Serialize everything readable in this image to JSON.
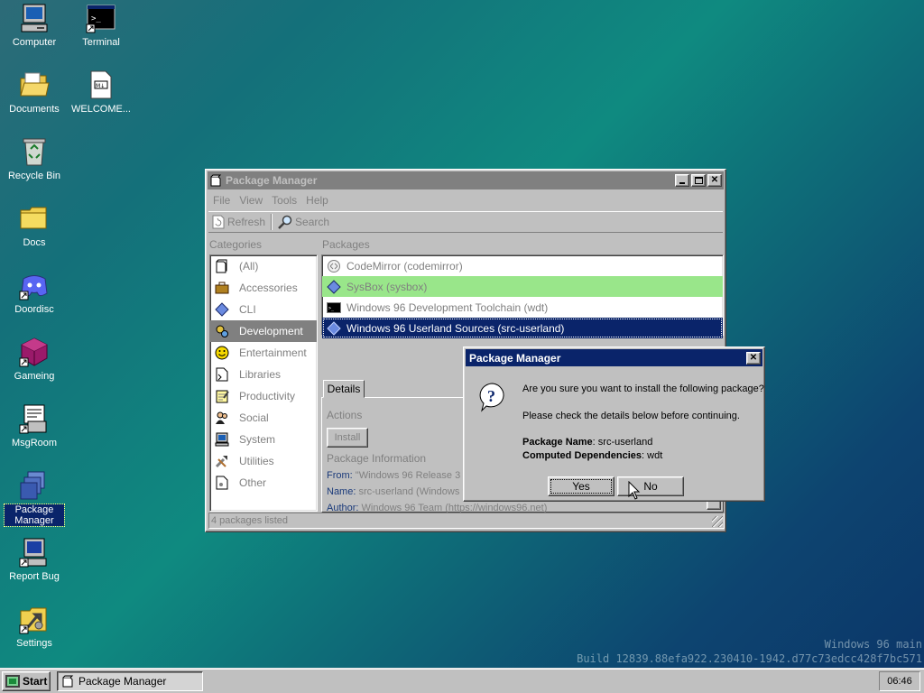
{
  "desktop": {
    "icons": [
      {
        "label": "Computer",
        "icon": "computer-icon"
      },
      {
        "label": "Terminal",
        "icon": "terminal-icon"
      },
      {
        "label": "Documents",
        "icon": "folder-open-icon"
      },
      {
        "label": "WELCOME...",
        "icon": "markdown-file-icon"
      },
      {
        "label": "Recycle Bin",
        "icon": "recycle-bin-icon"
      },
      {
        "label": "Docs",
        "icon": "folder-icon"
      },
      {
        "label": "Doordisc",
        "icon": "discord-icon"
      },
      {
        "label": "Gameing",
        "icon": "game-cube-icon"
      },
      {
        "label": "MsgRoom",
        "icon": "chat-icon"
      },
      {
        "label": "Package Manager",
        "icon": "package-icon"
      },
      {
        "label": "Report Bug",
        "icon": "bug-report-icon"
      },
      {
        "label": "Settings",
        "icon": "settings-icon"
      }
    ],
    "watermark": {
      "line1": "Windows 96 main",
      "line2": "Build 12839.88efa922.230410-1942.d77c73edcc428f7bc571"
    }
  },
  "window": {
    "title": "Package Manager",
    "menu": [
      "File",
      "View",
      "Tools",
      "Help"
    ],
    "toolbar": {
      "refresh": "Refresh",
      "search": "Search"
    },
    "categories_label": "Categories",
    "packages_label": "Packages",
    "categories": [
      {
        "label": "(All)",
        "icon": "all-icon"
      },
      {
        "label": "Accessories",
        "icon": "briefcase-icon"
      },
      {
        "label": "CLI",
        "icon": "diamond-icon"
      },
      {
        "label": "Development",
        "icon": "gears-icon",
        "selected": true
      },
      {
        "label": "Entertainment",
        "icon": "smiley-icon"
      },
      {
        "label": "Libraries",
        "icon": "library-icon"
      },
      {
        "label": "Productivity",
        "icon": "notepad-icon"
      },
      {
        "label": "Social",
        "icon": "people-icon"
      },
      {
        "label": "System",
        "icon": "monitor-icon"
      },
      {
        "label": "Utilities",
        "icon": "tools-icon"
      },
      {
        "label": "Other",
        "icon": "other-icon"
      }
    ],
    "packages": [
      {
        "label": "CodeMirror (codemirror)",
        "icon": "codemirror-icon",
        "state": "normal"
      },
      {
        "label": "SysBox (sysbox)",
        "icon": "diamond-icon",
        "state": "installed"
      },
      {
        "label": "Windows 96 Development Toolchain (wdt)",
        "icon": "terminal-icon",
        "state": "normal"
      },
      {
        "label": "Windows 96 Userland Sources (src-userland)",
        "icon": "diamond-icon",
        "state": "selected"
      }
    ],
    "details": {
      "tab": "Details",
      "actions_label": "Actions",
      "install_button": "Install",
      "info_label": "Package Information",
      "from_key": "From:",
      "from_value": "\"Windows 96 Release 3",
      "name_key": "Name:",
      "name_value": "src-userland (Windows 9",
      "author_key": "Author:",
      "author_value": "Windows 96 Team (https://windows96.net)"
    },
    "status": "4 packages listed"
  },
  "dialog": {
    "title": "Package Manager",
    "question": "Are you sure you want to install the following package?",
    "instruction": "Please check the details below before continuing.",
    "package_name_key": "Package Name",
    "package_name_value": ": src-userland",
    "deps_key": "Computed Dependencies",
    "deps_value": ": wdt",
    "yes": "Yes",
    "no": "No"
  },
  "taskbar": {
    "start": "Start",
    "task": "Package Manager",
    "clock": "06:46"
  }
}
